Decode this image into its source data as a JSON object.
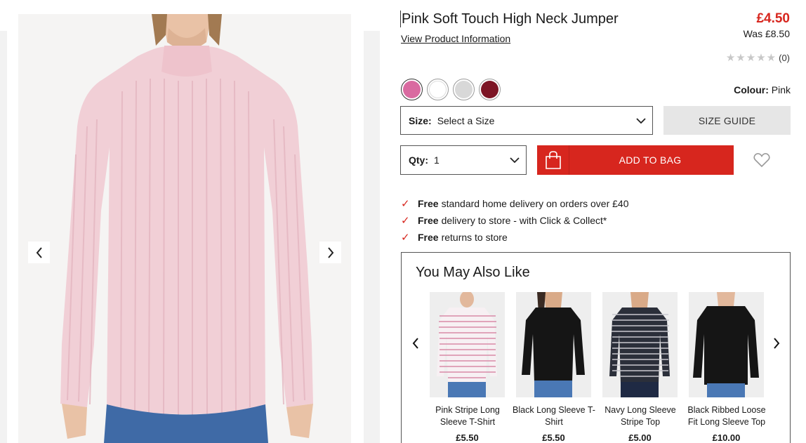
{
  "product": {
    "title": "Pink Soft Touch High Neck Jumper",
    "view_info_link": "View Product Information",
    "price": "£4.50",
    "was_price": "Was £8.50",
    "rating_count": "(0)",
    "colour_label": "Colour:",
    "colour_value": "Pink",
    "swatches": [
      {
        "name": "Pink",
        "color": "#d96aa0",
        "selected": true
      },
      {
        "name": "White",
        "color": "#ffffff",
        "selected": false
      },
      {
        "name": "Grey",
        "color": "#d8d8d8",
        "selected": false
      },
      {
        "name": "Burgundy",
        "color": "#7d1525",
        "selected": false
      }
    ],
    "accent_color": "#d7261e"
  },
  "size": {
    "label": "Size:",
    "value": "Select a Size"
  },
  "size_guide_label": "SIZE GUIDE",
  "qty": {
    "label": "Qty:",
    "value": "1"
  },
  "add_to_bag_label": "ADD TO BAG",
  "benefits": [
    {
      "bold": "Free",
      "text": "standard home delivery on orders over £40"
    },
    {
      "bold": "Free",
      "text": "delivery to store - with Click & Collect*"
    },
    {
      "bold": "Free",
      "text": "returns to store"
    }
  ],
  "recommendations": {
    "title": "You May Also Like",
    "items": [
      {
        "name": "Pink Stripe Long Sleeve T-Shirt",
        "price": "£5.50"
      },
      {
        "name": "Black Long Sleeve T-Shirt",
        "price": "£5.50"
      },
      {
        "name": "Navy Long Sleeve Stripe Top",
        "price": "£5.00"
      },
      {
        "name": "Black Ribbed Loose Fit Long Sleeve Top",
        "price": "£10.00"
      }
    ]
  }
}
